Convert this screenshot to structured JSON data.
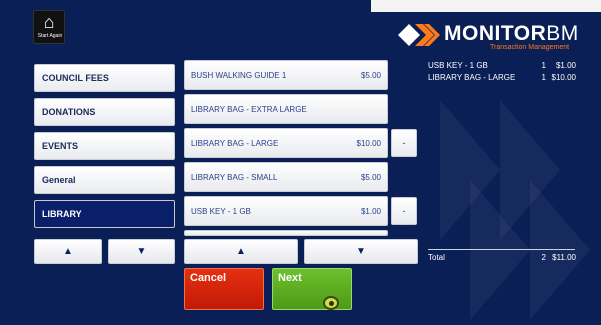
{
  "header": {
    "home_label": "Start Again",
    "brand_name": "MONITOR",
    "brand_suffix": "BM",
    "brand_tagline": "Transaction Management"
  },
  "categories": [
    {
      "label": "COUNCIL FEES",
      "active": false
    },
    {
      "label": "DONATIONS",
      "active": false
    },
    {
      "label": "EVENTS",
      "active": false
    },
    {
      "label": "General",
      "active": false
    },
    {
      "label": "LIBRARY",
      "active": true
    }
  ],
  "products": [
    {
      "name": "BUSH WALKING GUIDE 1",
      "price": "$5.00",
      "has_minus": false
    },
    {
      "name": "LIBRARY BAG - EXTRA LARGE",
      "price": "",
      "has_minus": false
    },
    {
      "name": "LIBRARY BAG - LARGE",
      "price": "$10.00",
      "has_minus": true
    },
    {
      "name": "LIBRARY BAG - SMALL",
      "price": "$5.00",
      "has_minus": false
    },
    {
      "name": "USB KEY - 1 GB",
      "price": "$1.00",
      "has_minus": true
    }
  ],
  "minus_label": "-",
  "scroll": {
    "up": "▲",
    "down": "▼"
  },
  "order": {
    "lines": [
      {
        "item": "USB KEY - 1 GB",
        "qty": "1",
        "amount": "$1.00"
      },
      {
        "item": "LIBRARY BAG - LARGE",
        "qty": "1",
        "amount": "$10.00"
      }
    ],
    "total_label": "Total",
    "total_qty": "2",
    "total_amount": "$11.00"
  },
  "actions": {
    "cancel": "Cancel",
    "next": "Next"
  },
  "colors": {
    "background": "#0a1f55",
    "active_category": "#0a1f6a",
    "cancel": "#d8260a",
    "next": "#5eae22",
    "brand_accent": "#ff7a1a"
  },
  "icons": {
    "home": "home-icon",
    "logo": "monitor-chevron-logo"
  }
}
